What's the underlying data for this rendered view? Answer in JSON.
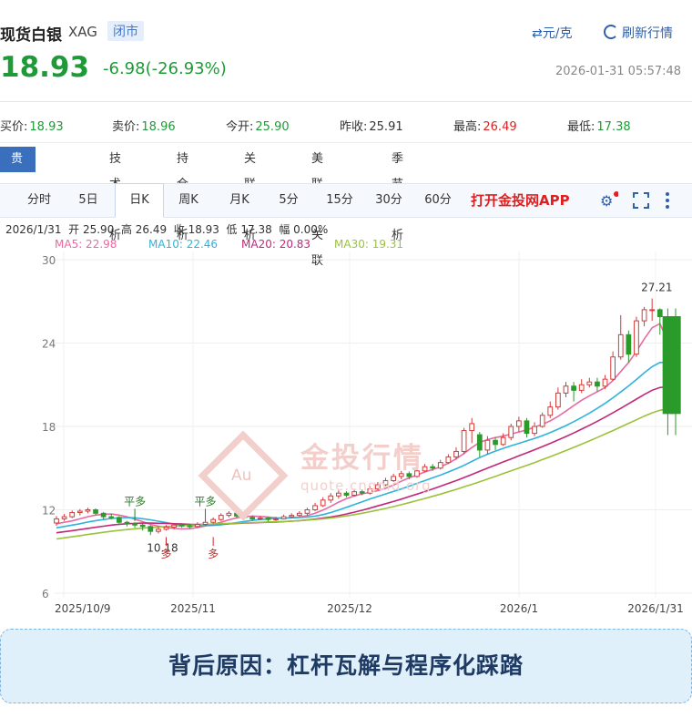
{
  "header": {
    "title": "现货白银",
    "code": "XAG",
    "status": "闭市",
    "unit_toggle": "⇄元/克",
    "refresh": "刷新行情",
    "price": "18.93",
    "change": "-6.98(-26.93%)",
    "timestamp": "2026-01-31 05:57:48"
  },
  "stats": [
    {
      "label": "买价:",
      "value": "18.93",
      "color": "#1f9a38"
    },
    {
      "label": "卖价:",
      "value": "18.96",
      "color": "#1f9a38"
    },
    {
      "label": "今开:",
      "value": "25.90",
      "color": "#1f9a38"
    },
    {
      "label": "昨收:",
      "value": "25.91",
      "color": "#333333"
    },
    {
      "label": "最高:",
      "value": "26.49",
      "color": "#dd2222"
    },
    {
      "label": "最低:",
      "value": "17.38",
      "color": "#1f9a38"
    }
  ],
  "analysis_tabs": [
    "贵金属分析",
    "技术分析",
    "持仓分析",
    "关联分析",
    "美联储关联",
    "季节分析"
  ],
  "periods": [
    "分时",
    "5日",
    "日K",
    "周K",
    "月K",
    "5分",
    "15分",
    "30分",
    "60分"
  ],
  "active_period": "日K",
  "app_link": "打开金投网APP",
  "toolbar_icons": [
    "settings-icon",
    "fullscreen-icon",
    "more-icon"
  ],
  "ohlc_line": "2026/1/31  开 25.90  高 26.49  收 18.93  低 17.38  幅 0.00%",
  "ma_legend": [
    {
      "label": "MA5: 22.98",
      "color": "#e86aa0"
    },
    {
      "label": "MA10: 22.46",
      "color": "#2fb3d9"
    },
    {
      "label": "MA20: 20.83",
      "color": "#c0287a"
    },
    {
      "label": "MA30: 19.31",
      "color": "#9bc23a"
    }
  ],
  "watermark": {
    "brand": "金投行情",
    "sub": "quote.cngold.org",
    "logo": "Au"
  },
  "chart_data": {
    "type": "candlestick",
    "y_ticks": [
      30,
      24,
      18,
      12,
      6
    ],
    "ylim": [
      6,
      30
    ],
    "x_ticks": [
      "2025/10/9",
      "2025/11",
      "2025/12",
      "2026/1",
      "2026/1/31"
    ],
    "annotations": [
      {
        "text": "27.21",
        "kind": "high"
      },
      {
        "text": "10.18",
        "kind": "low"
      },
      {
        "text": "平多",
        "kind": "signal"
      },
      {
        "text": "平多",
        "kind": "signal"
      },
      {
        "text": "多",
        "kind": "signal"
      },
      {
        "text": "多",
        "kind": "signal"
      }
    ],
    "candles": [
      [
        11.05,
        11.35,
        11.55,
        10.85
      ],
      [
        11.35,
        11.5,
        11.7,
        11.2
      ],
      [
        11.5,
        11.8,
        11.95,
        11.4
      ],
      [
        11.8,
        11.9,
        12.05,
        11.6
      ],
      [
        11.9,
        12.0,
        12.15,
        11.75
      ],
      [
        12.0,
        11.75,
        12.1,
        11.6
      ],
      [
        11.75,
        11.5,
        11.85,
        11.3
      ],
      [
        11.5,
        11.45,
        11.7,
        11.3
      ],
      [
        11.45,
        11.1,
        11.55,
        10.9
      ],
      [
        11.1,
        11.0,
        11.2,
        10.8
      ],
      [
        11.0,
        10.9,
        11.1,
        10.7
      ],
      [
        10.9,
        10.8,
        11.0,
        10.5
      ],
      [
        10.8,
        10.45,
        10.9,
        10.18
      ],
      [
        10.45,
        10.6,
        10.8,
        10.3
      ],
      [
        10.6,
        10.75,
        10.9,
        10.5
      ],
      [
        10.75,
        10.9,
        11.05,
        10.6
      ],
      [
        10.9,
        10.85,
        11.05,
        10.7
      ],
      [
        10.85,
        10.8,
        11.0,
        10.65
      ],
      [
        10.8,
        10.95,
        11.1,
        10.7
      ],
      [
        10.95,
        11.1,
        11.3,
        10.85
      ],
      [
        11.1,
        11.3,
        11.45,
        11.0
      ],
      [
        11.3,
        11.6,
        11.75,
        11.2
      ],
      [
        11.6,
        11.75,
        11.9,
        11.45
      ],
      [
        11.75,
        11.55,
        11.85,
        11.4
      ],
      [
        11.55,
        11.45,
        11.65,
        11.3
      ],
      [
        11.45,
        11.35,
        11.6,
        11.2
      ],
      [
        11.35,
        11.4,
        11.55,
        11.25
      ],
      [
        11.4,
        11.3,
        11.5,
        11.15
      ],
      [
        11.3,
        11.35,
        11.5,
        11.2
      ],
      [
        11.35,
        11.5,
        11.65,
        11.3
      ],
      [
        11.5,
        11.6,
        11.75,
        11.4
      ],
      [
        11.6,
        11.75,
        11.9,
        11.5
      ],
      [
        11.75,
        12.0,
        12.15,
        11.6
      ],
      [
        12.0,
        12.3,
        12.5,
        11.9
      ],
      [
        12.3,
        12.7,
        12.9,
        12.2
      ],
      [
        12.7,
        13.0,
        13.2,
        12.5
      ],
      [
        13.0,
        13.2,
        13.4,
        12.8
      ],
      [
        13.2,
        13.05,
        13.35,
        12.9
      ],
      [
        13.05,
        13.3,
        13.5,
        12.95
      ],
      [
        13.3,
        13.2,
        13.45,
        13.05
      ],
      [
        13.2,
        13.5,
        13.7,
        13.1
      ],
      [
        13.5,
        13.8,
        14.0,
        13.4
      ],
      [
        13.8,
        14.1,
        14.3,
        13.7
      ],
      [
        14.1,
        14.4,
        14.6,
        14.0
      ],
      [
        14.4,
        14.6,
        14.8,
        14.2
      ],
      [
        14.6,
        14.4,
        14.75,
        14.2
      ],
      [
        14.4,
        14.8,
        15.0,
        14.3
      ],
      [
        14.8,
        15.1,
        15.3,
        14.7
      ],
      [
        15.1,
        15.0,
        15.3,
        14.8
      ],
      [
        15.0,
        15.4,
        15.6,
        14.9
      ],
      [
        15.4,
        15.8,
        16.0,
        15.3
      ],
      [
        15.8,
        16.2,
        16.5,
        15.6
      ],
      [
        16.2,
        17.7,
        17.9,
        16.0
      ],
      [
        17.7,
        18.2,
        18.6,
        16.8
      ],
      [
        17.4,
        16.3,
        17.6,
        15.8
      ],
      [
        16.3,
        17.0,
        17.3,
        16.0
      ],
      [
        17.0,
        16.7,
        17.2,
        16.3
      ],
      [
        16.7,
        17.2,
        17.5,
        16.6
      ],
      [
        17.2,
        18.0,
        18.2,
        17.0
      ],
      [
        18.0,
        18.4,
        18.7,
        17.6
      ],
      [
        18.4,
        17.5,
        18.6,
        17.2
      ],
      [
        17.5,
        18.0,
        18.3,
        17.3
      ],
      [
        18.0,
        18.8,
        19.0,
        17.9
      ],
      [
        18.8,
        19.4,
        19.8,
        18.6
      ],
      [
        19.4,
        20.4,
        20.8,
        19.2
      ],
      [
        20.4,
        20.9,
        21.2,
        20.1
      ],
      [
        20.9,
        20.6,
        21.2,
        19.8
      ],
      [
        20.6,
        21.0,
        21.4,
        20.4
      ],
      [
        21.0,
        21.2,
        21.5,
        20.8
      ],
      [
        21.2,
        20.9,
        21.5,
        20.5
      ],
      [
        20.9,
        21.4,
        21.7,
        20.7
      ],
      [
        21.4,
        23.0,
        23.4,
        21.3
      ],
      [
        23.0,
        24.6,
        26.0,
        22.8
      ],
      [
        24.6,
        23.2,
        24.9,
        22.6
      ],
      [
        23.2,
        25.6,
        25.9,
        23.0
      ],
      [
        25.6,
        26.4,
        26.6,
        25.2
      ],
      [
        26.4,
        26.4,
        27.21,
        25.6
      ],
      [
        26.4,
        25.9,
        26.5,
        24.6
      ],
      [
        25.9,
        18.93,
        26.49,
        17.38
      ],
      [
        25.9,
        18.93,
        26.49,
        17.38
      ]
    ],
    "ma_series": {
      "MA5": [
        11.0,
        11.1,
        11.2,
        11.35,
        11.5,
        11.62,
        11.68,
        11.7,
        11.62,
        11.5,
        11.32,
        11.15,
        10.95,
        10.82,
        10.72,
        10.66,
        10.62,
        10.64,
        10.72,
        10.84,
        10.96,
        11.1,
        11.28,
        11.42,
        11.5,
        11.55,
        11.52,
        11.48,
        11.42,
        11.4,
        11.42,
        11.48,
        11.58,
        11.75,
        11.98,
        12.25,
        12.55,
        12.8,
        13.0,
        13.15,
        13.25,
        13.38,
        13.55,
        13.78,
        14.05,
        14.3,
        14.5,
        14.72,
        14.9,
        15.1,
        15.35,
        15.68,
        16.05,
        16.48,
        16.85,
        17.05,
        17.2,
        17.3,
        17.45,
        17.6,
        17.75,
        17.95,
        18.15,
        18.4,
        18.72,
        19.1,
        19.5,
        19.88,
        20.2,
        20.5,
        20.8,
        21.3,
        21.95,
        22.6,
        23.4,
        24.3,
        25.1,
        25.4,
        24.1,
        22.98
      ],
      "MA10": [
        10.7,
        10.8,
        10.9,
        11.0,
        11.12,
        11.22,
        11.3,
        11.38,
        11.42,
        11.45,
        11.42,
        11.36,
        11.28,
        11.18,
        11.08,
        10.98,
        10.9,
        10.86,
        10.84,
        10.85,
        10.88,
        10.92,
        11.0,
        11.08,
        11.16,
        11.24,
        11.3,
        11.35,
        11.38,
        11.4,
        11.42,
        11.44,
        11.48,
        11.55,
        11.65,
        11.8,
        11.98,
        12.18,
        12.38,
        12.58,
        12.78,
        12.96,
        13.14,
        13.32,
        13.5,
        13.7,
        13.9,
        14.1,
        14.3,
        14.5,
        14.72,
        14.95,
        15.2,
        15.48,
        15.76,
        16.0,
        16.22,
        16.42,
        16.6,
        16.78,
        16.96,
        17.14,
        17.34,
        17.56,
        17.8,
        18.06,
        18.34,
        18.64,
        18.96,
        19.3,
        19.66,
        20.06,
        20.48,
        20.92,
        21.38,
        21.86,
        22.3,
        22.6,
        22.6,
        22.46
      ],
      "MA20": [
        10.35,
        10.42,
        10.5,
        10.58,
        10.66,
        10.74,
        10.82,
        10.9,
        10.96,
        11.0,
        11.02,
        11.04,
        11.04,
        11.03,
        11.02,
        11.0,
        10.98,
        10.96,
        10.95,
        10.95,
        10.96,
        10.98,
        11.0,
        11.02,
        11.04,
        11.06,
        11.08,
        11.1,
        11.12,
        11.15,
        11.18,
        11.22,
        11.27,
        11.33,
        11.4,
        11.48,
        11.58,
        11.7,
        11.83,
        11.97,
        12.12,
        12.28,
        12.44,
        12.6,
        12.77,
        12.95,
        13.13,
        13.31,
        13.5,
        13.7,
        13.9,
        14.1,
        14.32,
        14.54,
        14.77,
        15.0,
        15.22,
        15.44,
        15.66,
        15.88,
        16.1,
        16.32,
        16.55,
        16.78,
        17.02,
        17.27,
        17.53,
        17.8,
        18.08,
        18.37,
        18.67,
        18.98,
        19.3,
        19.63,
        19.97,
        20.3,
        20.6,
        20.8,
        20.85,
        20.83
      ],
      "MA30": [
        9.9,
        9.98,
        10.06,
        10.14,
        10.22,
        10.3,
        10.38,
        10.45,
        10.52,
        10.58,
        10.63,
        10.68,
        10.72,
        10.76,
        10.8,
        10.83,
        10.86,
        10.89,
        10.92,
        10.95,
        10.98,
        11.0,
        11.02,
        11.04,
        11.06,
        11.08,
        11.1,
        11.12,
        11.14,
        11.16,
        11.19,
        11.22,
        11.26,
        11.3,
        11.35,
        11.41,
        11.48,
        11.56,
        11.65,
        11.75,
        11.86,
        11.98,
        12.1,
        12.23,
        12.37,
        12.51,
        12.66,
        12.81,
        12.97,
        13.13,
        13.3,
        13.47,
        13.65,
        13.83,
        14.02,
        14.21,
        14.4,
        14.6,
        14.8,
        15.0,
        15.2,
        15.4,
        15.61,
        15.82,
        16.04,
        16.26,
        16.49,
        16.72,
        16.96,
        17.2,
        17.45,
        17.7,
        17.96,
        18.22,
        18.48,
        18.74,
        18.98,
        19.16,
        19.27,
        19.31
      ]
    }
  },
  "banner": {
    "text": "背后原因：杠杆瓦解与程序化踩踏"
  }
}
